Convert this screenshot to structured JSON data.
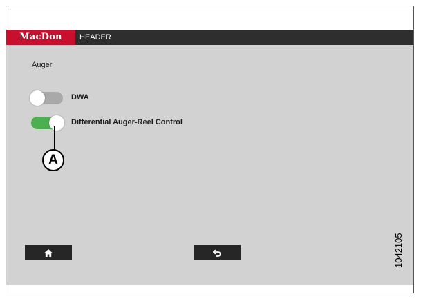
{
  "titlebar": {
    "logo_text": "MacDon",
    "tab_label": "HEADER",
    "brand_color": "#c8102e"
  },
  "auger_page": {
    "section_title": "Auger",
    "toggles": [
      {
        "label": "DWA",
        "state": "off"
      },
      {
        "label": "Differential Auger-Reel Control",
        "state": "on"
      }
    ],
    "toggle_on_color": "#4caf50",
    "toggle_off_color": "#a9a9a9"
  },
  "callout": {
    "label": "A"
  },
  "footer": {
    "home_icon": "home-icon",
    "back_icon": "back-arrow-icon"
  },
  "figure": {
    "id": "1042105"
  }
}
